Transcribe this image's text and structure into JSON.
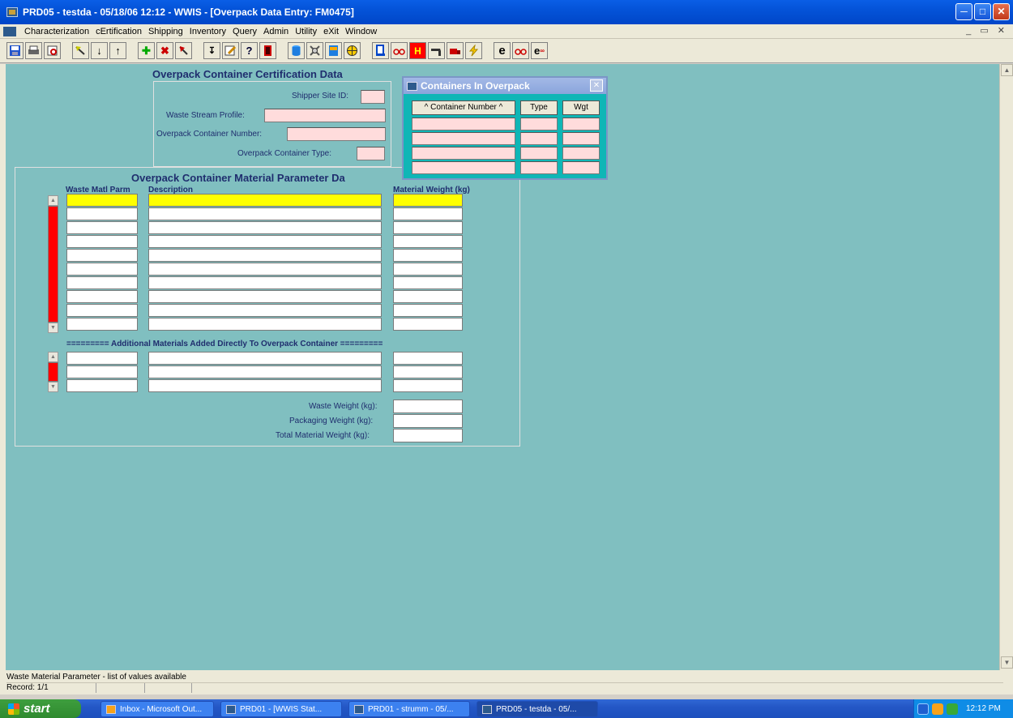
{
  "window": {
    "title": "PRD05 - testda - 05/18/06 12:12 - WWIS - [Overpack Data Entry: FM0475]"
  },
  "menu": {
    "items": [
      "Characterization",
      "cErtification",
      "Shipping",
      "Inventory",
      "Query",
      "Admin",
      "Utility",
      "eXit",
      "Window"
    ]
  },
  "toolbar": {
    "icons": [
      "save-icon",
      "print-icon",
      "print-preview-icon",
      "enter-query-icon",
      "next-record-icon",
      "previous-record-icon",
      "insert-record-icon",
      "delete-record-icon",
      "clear-icon",
      "lov-icon",
      "edit-icon",
      "help-icon",
      "exit-icon",
      "database-icon",
      "tools-icon",
      "report-icon",
      "target-icon",
      "lock-icon",
      "glasses-icon",
      "h-icon",
      "tool-icon",
      "truck-icon",
      "lightning-icon",
      "e-icon",
      "glasses2-icon",
      "e-wizard-icon"
    ]
  },
  "form": {
    "cert_header": "Overpack Container Certification Data",
    "shipper_site_label": "Shipper Site ID:",
    "waste_stream_label": "Waste Stream Profile:",
    "overpack_number_label": "Overpack Container Number:",
    "overpack_type_label": "Overpack Container Type:",
    "material_header": "Overpack Container Material Parameter Da",
    "col_waste_matl": "Waste Matl Parm",
    "col_description": "Description",
    "col_material_weight": "Material Weight (kg)",
    "additional_divider": "=========  Additional Materials Added Directly To Overpack Container  =========",
    "waste_weight_label": "Waste Weight (kg):",
    "packaging_weight_label": "Packaging Weight (kg):",
    "total_weight_label": "Total Material Weight (kg):"
  },
  "popup": {
    "title": "Containers In Overpack",
    "col_container": "^ Container Number ^",
    "col_type": "Type",
    "col_wgt": "Wgt"
  },
  "statusbar": {
    "message": "Waste Material Parameter - list of values available",
    "record": "Record: 1/1"
  },
  "taskbar": {
    "start": "start",
    "items": [
      "Inbox - Microsoft Out...",
      "PRD01 - [WWIS Stat...",
      "PRD01 - strumm - 05/...",
      "PRD05 - testda - 05/..."
    ],
    "clock": "12:12 PM"
  }
}
